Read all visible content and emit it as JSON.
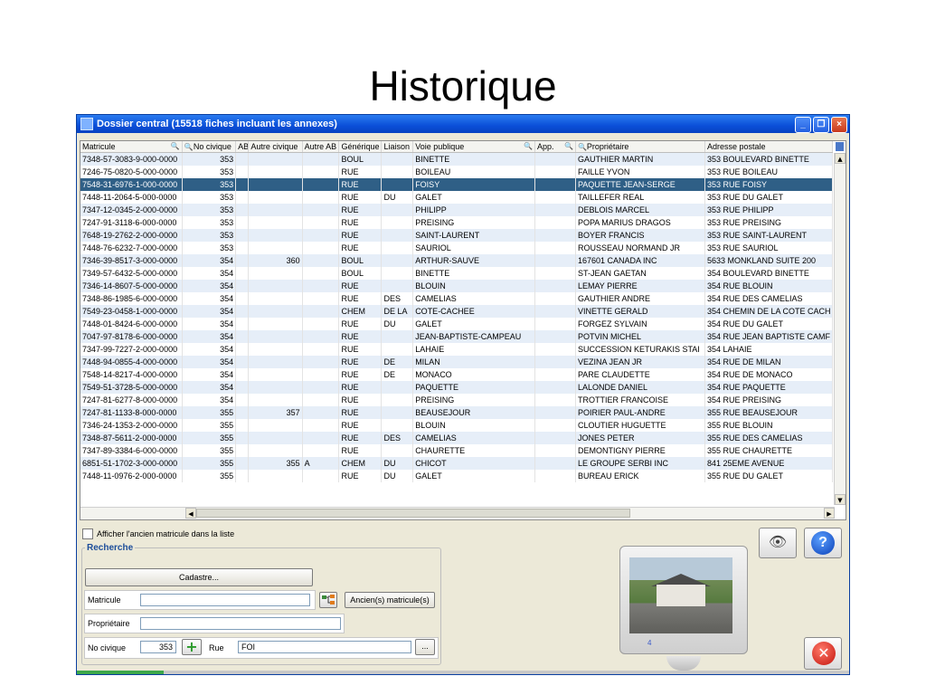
{
  "slide_title": "Historique",
  "window": {
    "title": "Dossier central (15518 fiches incluant les annexes)",
    "minimize": "_",
    "maximize": "❐",
    "close": "×"
  },
  "grid": {
    "columns": [
      "Matricule",
      "No civique",
      "AB",
      "Autre civique",
      "Autre AB",
      "Générique",
      "Liaison",
      "Voie publique",
      "App.",
      "Propriétaire",
      "Adresse postale"
    ],
    "rows": [
      [
        "7348-57-3083-9-000-0000",
        "353",
        "",
        "",
        "",
        "BOUL",
        "",
        "BINETTE",
        "",
        "GAUTHIER MARTIN",
        "353 BOULEVARD BINETTE"
      ],
      [
        "7246-75-0820-5-000-0000",
        "353",
        "",
        "",
        "",
        "RUE",
        "",
        "BOILEAU",
        "",
        "FAILLE YVON",
        "353 RUE BOILEAU"
      ],
      [
        "7548-31-6976-1-000-0000",
        "353",
        "",
        "",
        "",
        "RUE",
        "",
        "FOISY",
        "",
        "PAQUETTE JEAN-SERGE",
        "353 RUE FOISY"
      ],
      [
        "7448-11-2064-5-000-0000",
        "353",
        "",
        "",
        "",
        "RUE",
        "DU",
        "GALET",
        "",
        "TAILLEFER REAL",
        "353 RUE DU GALET"
      ],
      [
        "7347-12-0345-2-000-0000",
        "353",
        "",
        "",
        "",
        "RUE",
        "",
        "PHILIPP",
        "",
        "DEBLOIS MARCEL",
        "353 RUE PHILIPP"
      ],
      [
        "7247-91-3118-6-000-0000",
        "353",
        "",
        "",
        "",
        "RUE",
        "",
        "PREISING",
        "",
        "POPA MARIUS DRAGOS",
        "353 RUE PREISING"
      ],
      [
        "7648-19-2762-2-000-0000",
        "353",
        "",
        "",
        "",
        "RUE",
        "",
        "SAINT-LAURENT",
        "",
        "BOYER FRANCIS",
        "353 RUE SAINT-LAURENT"
      ],
      [
        "7448-76-6232-7-000-0000",
        "353",
        "",
        "",
        "",
        "RUE",
        "",
        "SAURIOL",
        "",
        "ROUSSEAU NORMAND JR",
        "353 RUE SAURIOL"
      ],
      [
        "7346-39-8517-3-000-0000",
        "354",
        "",
        "360",
        "",
        "BOUL",
        "",
        "ARTHUR-SAUVE",
        "",
        "167601 CANADA INC",
        "5633 MONKLAND SUITE 200"
      ],
      [
        "7349-57-6432-5-000-0000",
        "354",
        "",
        "",
        "",
        "BOUL",
        "",
        "BINETTE",
        "",
        "ST-JEAN GAETAN",
        "354 BOULEVARD BINETTE"
      ],
      [
        "7346-14-8607-5-000-0000",
        "354",
        "",
        "",
        "",
        "RUE",
        "",
        "BLOUIN",
        "",
        "LEMAY PIERRE",
        "354 RUE BLOUIN"
      ],
      [
        "7348-86-1985-6-000-0000",
        "354",
        "",
        "",
        "",
        "RUE",
        "DES",
        "CAMELIAS",
        "",
        "GAUTHIER ANDRE",
        "354 RUE DES CAMELIAS"
      ],
      [
        "7549-23-0458-1-000-0000",
        "354",
        "",
        "",
        "",
        "CHEM",
        "DE LA",
        "COTE-CACHEE",
        "",
        "VINETTE GERALD",
        "354 CHEMIN DE LA COTE CACH"
      ],
      [
        "7448-01-8424-6-000-0000",
        "354",
        "",
        "",
        "",
        "RUE",
        "DU",
        "GALET",
        "",
        "FORGEZ SYLVAIN",
        "354 RUE DU GALET"
      ],
      [
        "7047-97-8178-6-000-0000",
        "354",
        "",
        "",
        "",
        "RUE",
        "",
        "JEAN-BAPTISTE-CAMPEAU",
        "",
        "POTVIN MICHEL",
        "354 RUE JEAN BAPTISTE CAMF"
      ],
      [
        "7347-99-7227-2-000-0000",
        "354",
        "",
        "",
        "",
        "RUE",
        "",
        "LAHAIE",
        "",
        "SUCCESSION KETURAKIS STAI",
        "354 LAHAIE"
      ],
      [
        "7448-94-0855-4-000-0000",
        "354",
        "",
        "",
        "",
        "RUE",
        "DE",
        "MILAN",
        "",
        "VEZINA JEAN JR",
        "354 RUE DE MILAN"
      ],
      [
        "7548-14-8217-4-000-0000",
        "354",
        "",
        "",
        "",
        "RUE",
        "DE",
        "MONACO",
        "",
        "PARE CLAUDETTE",
        "354 RUE DE MONACO"
      ],
      [
        "7549-51-3728-5-000-0000",
        "354",
        "",
        "",
        "",
        "RUE",
        "",
        "PAQUETTE",
        "",
        "LALONDE DANIEL",
        "354 RUE PAQUETTE"
      ],
      [
        "7247-81-6277-8-000-0000",
        "354",
        "",
        "",
        "",
        "RUE",
        "",
        "PREISING",
        "",
        "TROTTIER FRANCOISE",
        "354 RUE PREISING"
      ],
      [
        "7247-81-1133-8-000-0000",
        "355",
        "",
        "357",
        "",
        "RUE",
        "",
        "BEAUSEJOUR",
        "",
        "POIRIER PAUL-ANDRE",
        "355 RUE BEAUSEJOUR"
      ],
      [
        "7346-24-1353-2-000-0000",
        "355",
        "",
        "",
        "",
        "RUE",
        "",
        "BLOUIN",
        "",
        "CLOUTIER HUGUETTE",
        "355 RUE BLOUIN"
      ],
      [
        "7348-87-5611-2-000-0000",
        "355",
        "",
        "",
        "",
        "RUE",
        "DES",
        "CAMELIAS",
        "",
        "JONES PETER",
        "355 RUE DES CAMELIAS"
      ],
      [
        "7347-89-3384-6-000-0000",
        "355",
        "",
        "",
        "",
        "RUE",
        "",
        "CHAURETTE",
        "",
        "DEMONTIGNY PIERRE",
        "355 RUE CHAURETTE"
      ],
      [
        "6851-51-1702-3-000-0000",
        "355",
        "",
        "355",
        "A",
        "CHEM",
        "DU",
        "CHICOT",
        "",
        "LE GROUPE SERBI INC",
        "841 25EME AVENUE"
      ],
      [
        "7448-11-0976-2-000-0000",
        "355",
        "",
        "",
        "",
        "RUE",
        "DU",
        "GALET",
        "",
        "BUREAU ERICK",
        "355 RUE DU GALET"
      ]
    ],
    "selected_row": 2
  },
  "show_old_label": "Afficher l'ancien matricule dans la liste",
  "search": {
    "legend": "Recherche",
    "cadastre_label": "Cadastre...",
    "matricule_label": "Matricule",
    "matricule_value": "",
    "old_matricule_label": "Ancien(s) matricule(s)",
    "proprietaire_label": "Propriétaire",
    "proprietaire_value": "",
    "no_civique_label": "No civique",
    "no_civique_value": "353",
    "rue_label": "Rue",
    "rue_value": "FOI",
    "browse_label": "..."
  },
  "preview": {
    "photo_index": "4"
  },
  "icons": {
    "eye": "eye-icon",
    "help": "help-icon",
    "close": "close-icon",
    "plus": "plus-icon",
    "tree": "tree-icon"
  }
}
